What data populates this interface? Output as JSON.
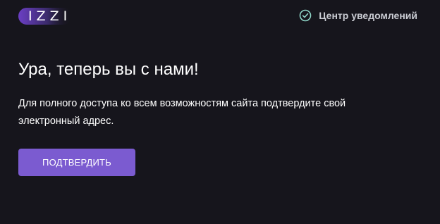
{
  "header": {
    "logo_text": "IZZI",
    "notifications_label": "Центр уведомлений",
    "notifications_icon": "check-circle-icon"
  },
  "main": {
    "title": "Ура, теперь вы с нами!",
    "description": "Для полного доступа ко всем возможностям сайта подтвердите свой электронный адрес.",
    "confirm_label": "ПОДТВЕРДИТЬ"
  },
  "colors": {
    "background": "#16151c",
    "accent": "#7b5bd0",
    "logo_gradient_start": "#6b3fc4",
    "logo_gradient_end": "#16151c",
    "icon_color": "#8fd6c8"
  }
}
